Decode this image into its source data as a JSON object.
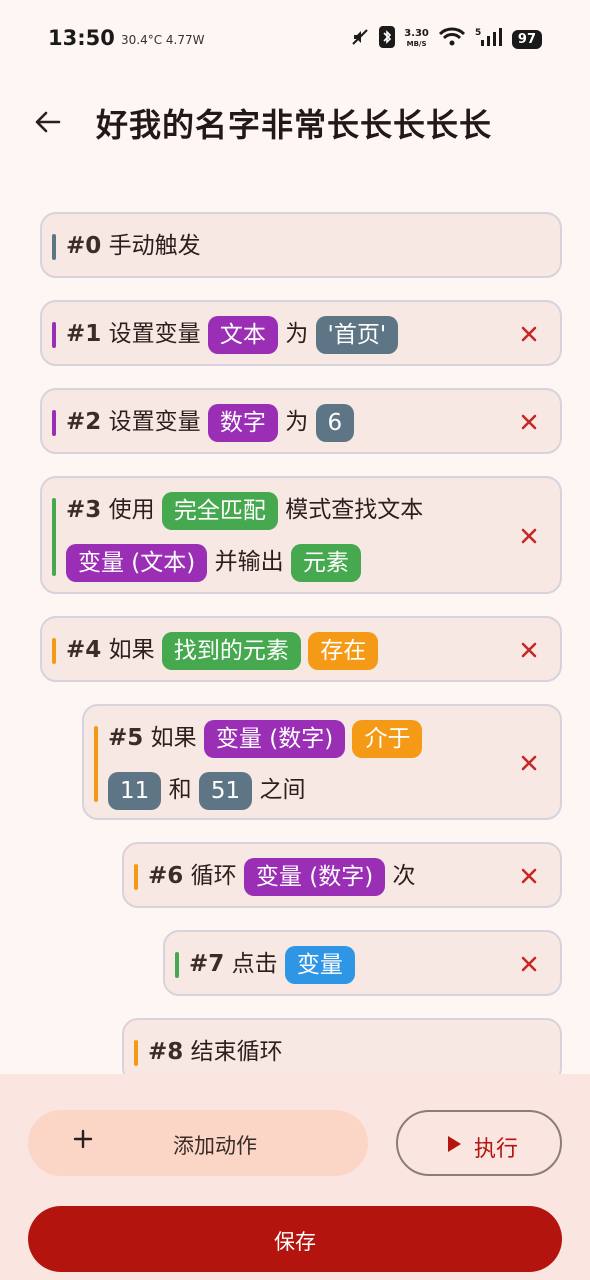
{
  "status_bar": {
    "time": "13:50",
    "info": "30.4°C  4.77W",
    "speed_value": "3.30",
    "speed_unit": "MB/S",
    "battery": "97"
  },
  "header": {
    "title": "好我的名字非常长长长长长"
  },
  "colors": {
    "purple": "#9a2eb5",
    "slate": "#5d7584",
    "green": "#46a84f",
    "orange": "#f59a16",
    "blue": "#2f96e6",
    "delete": "#c62828",
    "primary": "#b3150e"
  },
  "actions": [
    {
      "num": "#0",
      "words": [
        "手动触发"
      ]
    },
    {
      "num": "#1",
      "words": [
        "设置变量",
        "为"
      ],
      "chips": [
        "文本",
        "'首页'"
      ]
    },
    {
      "num": "#2",
      "words": [
        "设置变量",
        "为"
      ],
      "chips": [
        "数字",
        "6"
      ]
    },
    {
      "num": "#3",
      "words": [
        "使用",
        "模式查找文本",
        "并输出"
      ],
      "chips": [
        "完全匹配",
        "变量 (文本)",
        "元素"
      ]
    },
    {
      "num": "#4",
      "words": [
        "如果"
      ],
      "chips": [
        "找到的元素",
        "存在"
      ]
    },
    {
      "num": "#5",
      "words": [
        "如果",
        "和",
        "之间"
      ],
      "chips": [
        "变量 (数字)",
        "介于",
        "11",
        "51"
      ]
    },
    {
      "num": "#6",
      "words": [
        "循环",
        "次"
      ],
      "chips": [
        "变量 (数字)"
      ]
    },
    {
      "num": "#7",
      "words": [
        "点击"
      ],
      "chips": [
        "变量"
      ]
    },
    {
      "num": "#8",
      "words": [
        "结束循环"
      ]
    }
  ],
  "buttons": {
    "add": "添加动作",
    "run": "执行",
    "save": "保存"
  }
}
